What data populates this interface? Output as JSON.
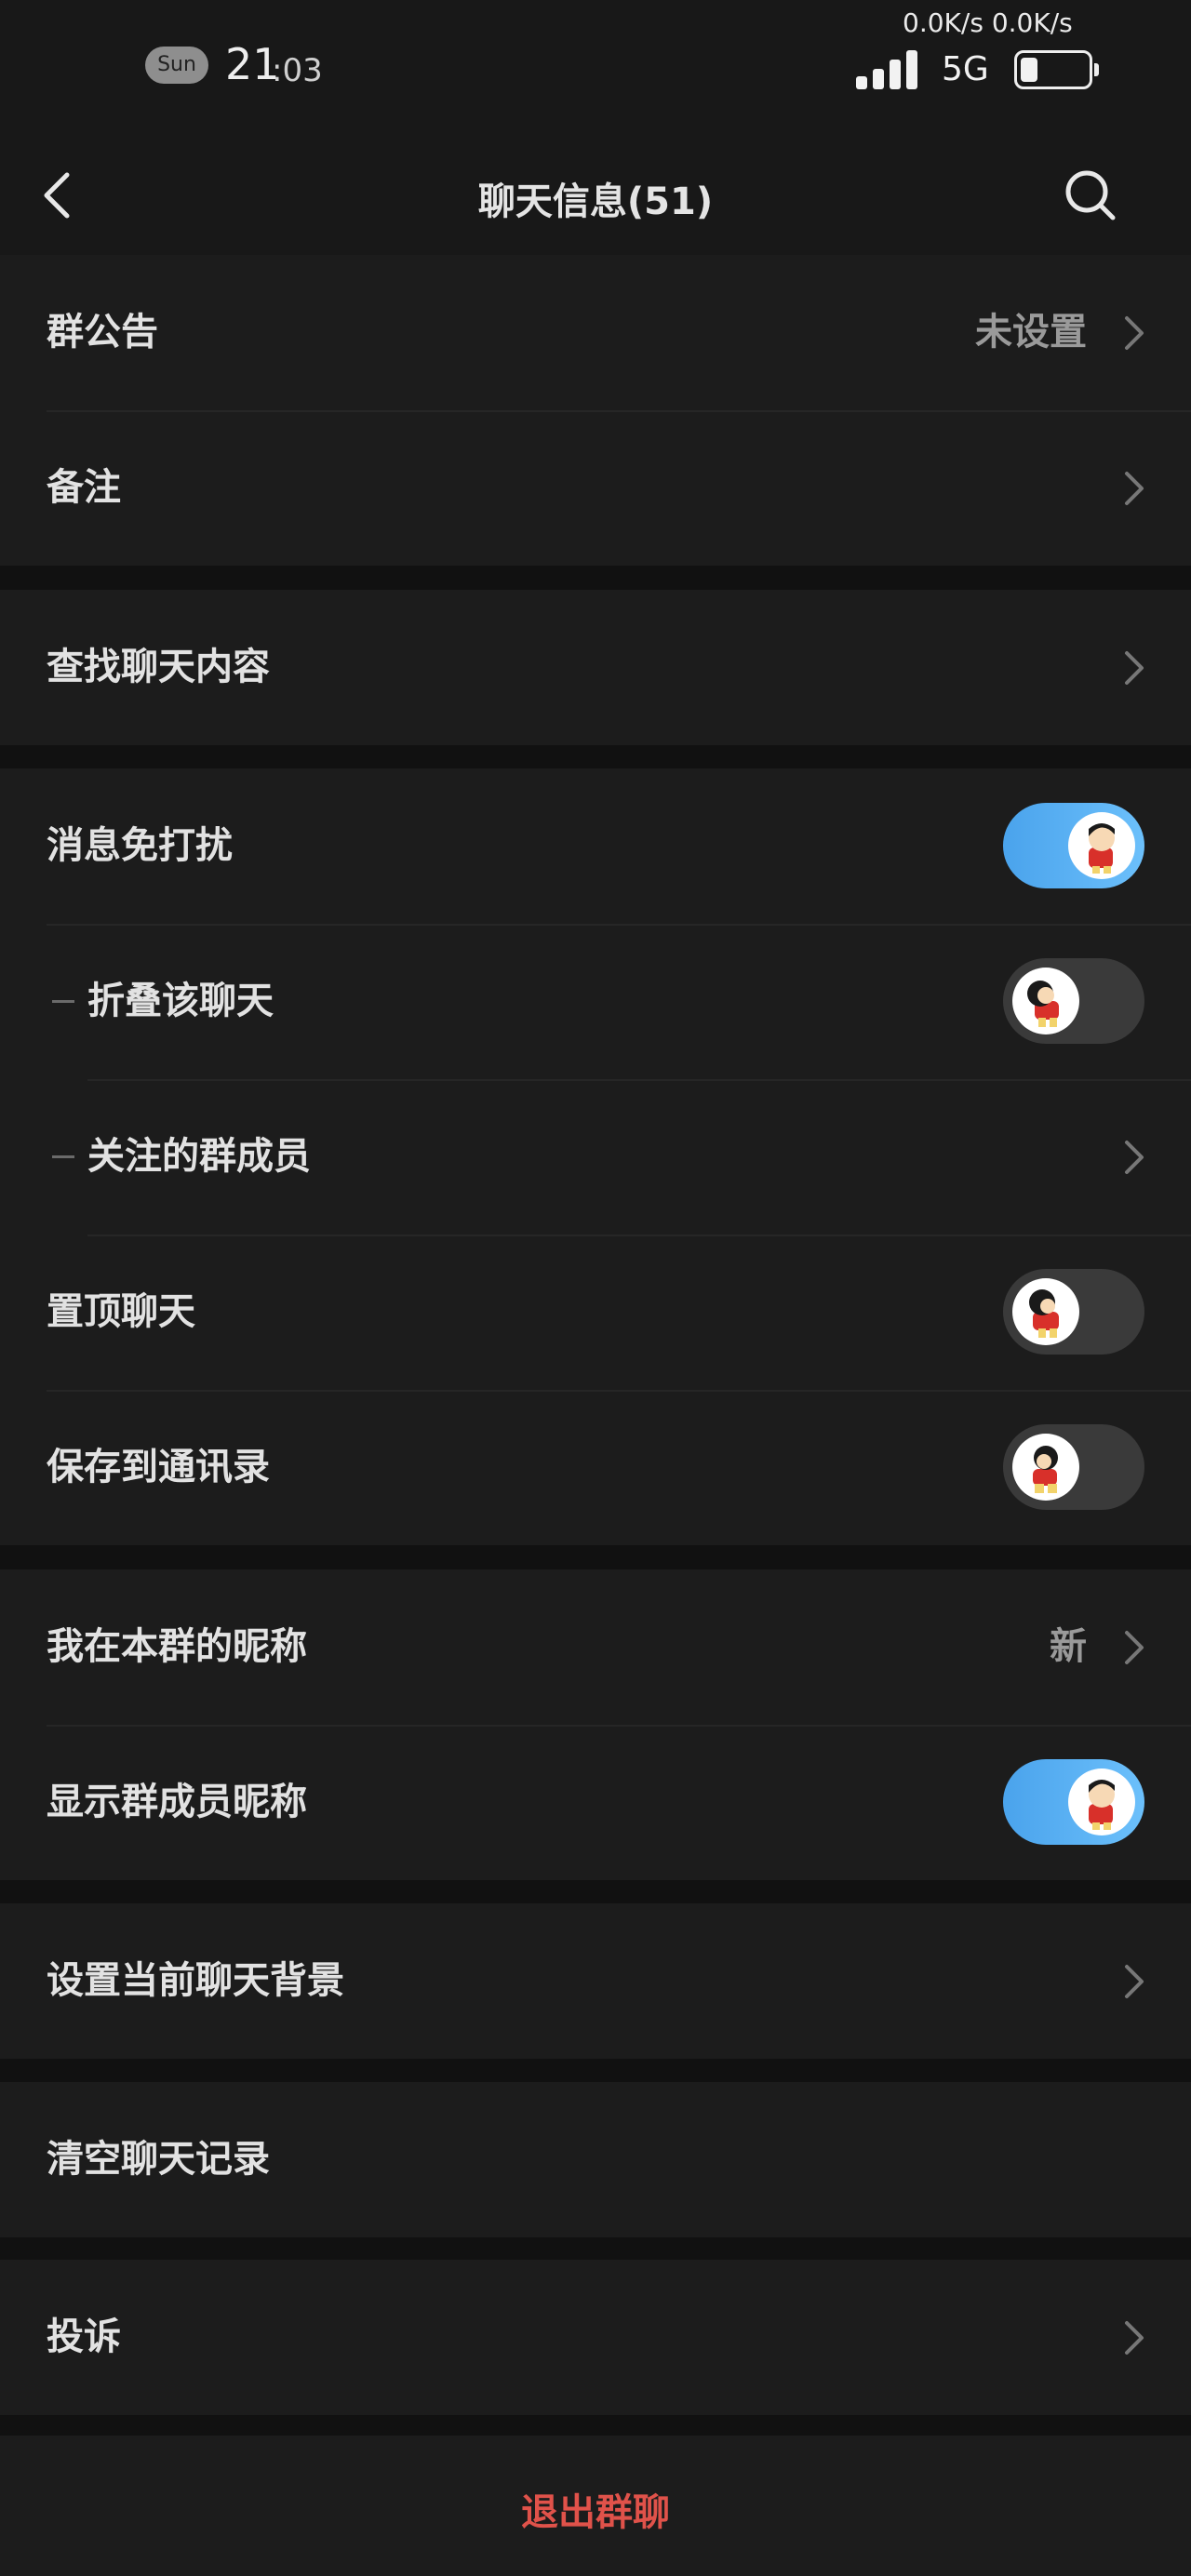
{
  "status_bar": {
    "day": "Sun",
    "time_hour": "21",
    "time_minute": ":03",
    "network_speed": "0.0K/s 0.0K/s",
    "network_type": "5G",
    "icons": [
      "signal-icon",
      "battery-icon"
    ]
  },
  "header": {
    "title": "聊天信息(51)",
    "icons": [
      "back-icon",
      "search-icon"
    ]
  },
  "groups": [
    {
      "rows": [
        {
          "label": "群公告",
          "value": "未设置",
          "type": "link"
        },
        {
          "label": "备注",
          "type": "link"
        }
      ]
    },
    {
      "rows": [
        {
          "label": "查找聊天内容",
          "type": "link"
        }
      ]
    },
    {
      "rows": [
        {
          "label": "消息免打扰",
          "type": "toggle",
          "on": true
        },
        {
          "label": "折叠该聊天",
          "type": "toggle",
          "on": false,
          "indent": true
        },
        {
          "label": "关注的群成员",
          "type": "link",
          "indent": true
        },
        {
          "label": "置顶聊天",
          "type": "toggle",
          "on": false
        },
        {
          "label": "保存到通讯录",
          "type": "toggle",
          "on": false
        }
      ]
    },
    {
      "rows": [
        {
          "label": "我在本群的昵称",
          "value": "新",
          "type": "link"
        },
        {
          "label": "显示群成员昵称",
          "type": "toggle",
          "on": true
        }
      ]
    },
    {
      "rows": [
        {
          "label": "设置当前聊天背景",
          "type": "link"
        }
      ]
    },
    {
      "rows": [
        {
          "label": "清空聊天记录",
          "type": "plain"
        }
      ]
    },
    {
      "rows": [
        {
          "label": "投诉",
          "type": "link"
        }
      ]
    }
  ],
  "footer": {
    "exit_label": "退出群聊"
  },
  "colors": {
    "background": "#111111",
    "row_background": "#1c1c1c",
    "toggle_on": "#55aef2",
    "toggle_off": "#3a3a3a",
    "danger": "#e0524a"
  }
}
